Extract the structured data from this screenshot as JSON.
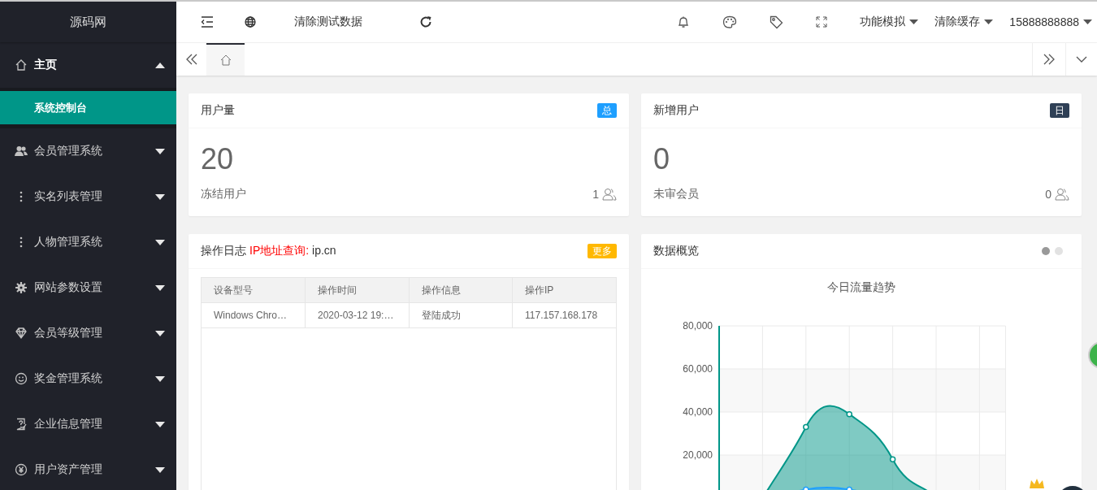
{
  "logo": "源码网",
  "sidebar": {
    "items": [
      {
        "label": "主页",
        "expanded": true,
        "children": [
          {
            "label": "系统控制台",
            "selected": true
          }
        ]
      },
      {
        "label": "会员管理系统",
        "expanded": false
      },
      {
        "label": "实名列表管理",
        "expanded": false
      },
      {
        "label": "人物管理系统",
        "expanded": false
      },
      {
        "label": "网站参数设置",
        "expanded": false
      },
      {
        "label": "会员等级管理",
        "expanded": false
      },
      {
        "label": "奖金管理系统",
        "expanded": false
      },
      {
        "label": "企业信息管理",
        "expanded": false
      },
      {
        "label": "用户资产管理",
        "expanded": false
      }
    ]
  },
  "header": {
    "clear_test_data": "清除测试数据",
    "menus": [
      "功能模拟",
      "清除缓存",
      "15888888888"
    ]
  },
  "tabs": [
    {
      "selected": true
    }
  ],
  "stat_cards": [
    {
      "title": "用户量",
      "badge": "总",
      "color": "#1e9fff",
      "value": "20",
      "sub_label": "冻结用户",
      "count": "1"
    },
    {
      "title": "新增用户",
      "badge": "日",
      "color": "#2f4056",
      "value": "0",
      "sub_label": "未审会员",
      "count": "0"
    }
  ],
  "log_card": {
    "title": "操作日志",
    "link_label": "IP地址查询:",
    "link": "ip.cn",
    "badge": "更多",
    "table": {
      "columns": [
        "设备型号",
        "操作时间",
        "操作信息",
        "操作IP"
      ],
      "rows": [
        [
          "Windows Chro…",
          "2020-03-12 19:…",
          "登陆成功",
          "117.157.168.178"
        ]
      ]
    }
  },
  "overview_card": {
    "title": "数据概览",
    "indicators": [
      {
        "selected": true
      },
      {
        "selected": false
      }
    ],
    "chart_data": {
      "type": "area",
      "grid": true,
      "title": "今日流量趋势",
      "categories": [
        null,
        null,
        null,
        null,
        null,
        null,
        null
      ],
      "ylim": [
        0,
        80000
      ],
      "yticks": [
        {
          "value": 20000,
          "label": "20,000"
        },
        {
          "value": 40000,
          "label": "40,000"
        },
        {
          "value": 60000,
          "label": "60,000"
        },
        {
          "value": 80000,
          "label": "80,000"
        }
      ],
      "series": [
        {
          "color": "#009688",
          "values": [
            0,
            0,
            33000,
            39000,
            18000,
            500,
            0
          ]
        },
        {
          "color": "#1e9fff",
          "values": [
            0,
            0,
            4000,
            4000,
            500,
            0,
            0
          ]
        }
      ]
    }
  }
}
